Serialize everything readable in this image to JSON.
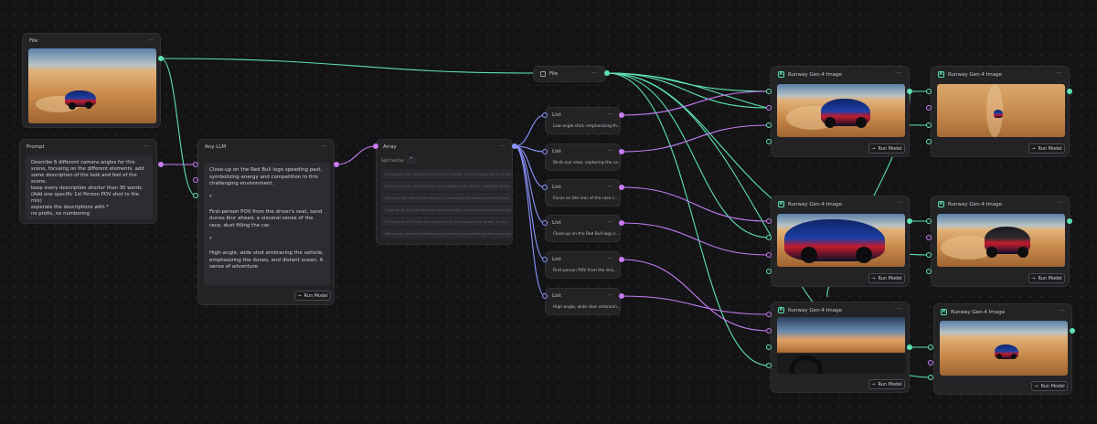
{
  "nodes": {
    "file1": {
      "title": "File",
      "menu": "···"
    },
    "prompt": {
      "title": "Prompt",
      "menu": "···",
      "text": "Describe 6 different camera angles for this scene, focusing on the different elements. add some description of the look and feel of the scene.\nkeep every description shorter than 30 words.\n(Add one specific 1st Person POV shot to the mix)\nseperate the descriptions with *\nno prefix, no numbering"
    },
    "llm": {
      "title": "Any LLM",
      "menu": "···",
      "output": "Close-up on the Red Bull logo speeding past, symbolizing energy and competition in this challenging environment.\n\n*\n\nFirst-person POV from the driver's seat, sand dunes blur ahead, a visceral sense of the race, dust filling the car.\n\n*\n\nHigh-angle, wide shot embracing the vehicle, emphasizing the dunes, and distant ocean. A sense of adventure.",
      "run_label": "Run Model"
    },
    "array": {
      "title": "Array",
      "menu": "···",
      "split_label": "Split text by:",
      "split_value": "*",
      "rows": [
        "Low-angle shot, emphasizing the car's power and dirt spray as the truck speeds",
        "Birds eye view, capturing the car navigating the dunes, highlighting the",
        "Focus on the rear of the race car, showcasing the design and the flying",
        "Close-up on the Red Bull logo speeding past, symbolizing energy and co",
        "First-person POV from the driver's seat, sand dunes blur ahead, a visc",
        "High-angle, wide shot embracing the vehicle, emphasizing the dunes an"
      ]
    },
    "file2": {
      "title": "File",
      "menu": "···"
    },
    "lists": [
      {
        "title": "List",
        "menu": "···",
        "text": "Low-angle shot, emphasizing th..."
      },
      {
        "title": "List",
        "menu": "···",
        "text": "Birds eye view, capturing the ca..."
      },
      {
        "title": "List",
        "menu": "···",
        "text": "Focus on the rear of the race c..."
      },
      {
        "title": "List",
        "menu": "···",
        "text": "Close-up on the Red Bull logo s..."
      },
      {
        "title": "List",
        "menu": "···",
        "text": "First-person POV from the driv..."
      },
      {
        "title": "List",
        "menu": "···",
        "text": "High-angle, wide shot embracin..."
      }
    ],
    "runway": [
      {
        "title": "Runway Gen-4 Image",
        "menu": "···",
        "run_label": "Run Model"
      },
      {
        "title": "Runway Gen-4 Image",
        "menu": "···",
        "run_label": "Run Model"
      },
      {
        "title": "Runway Gen-4 Image",
        "menu": "···",
        "run_label": "Run Model"
      },
      {
        "title": "Runway Gen-4 Image",
        "menu": "···",
        "run_label": "Run Model"
      },
      {
        "title": "Runway Gen-4 Image",
        "menu": "···",
        "run_label": "Run Model"
      },
      {
        "title": "Runway Gen-4 Image",
        "menu": "···",
        "run_label": "Run Model"
      }
    ]
  },
  "icons": {
    "runway": "runway-logo-icon",
    "file": "image-file-icon",
    "run": "arrow-right-icon"
  },
  "colors": {
    "image_wire": "#5de2b2",
    "text_wire": "#c77cf2",
    "list_wire": "#8c95ff",
    "background": "#141416",
    "node": "#232326"
  }
}
